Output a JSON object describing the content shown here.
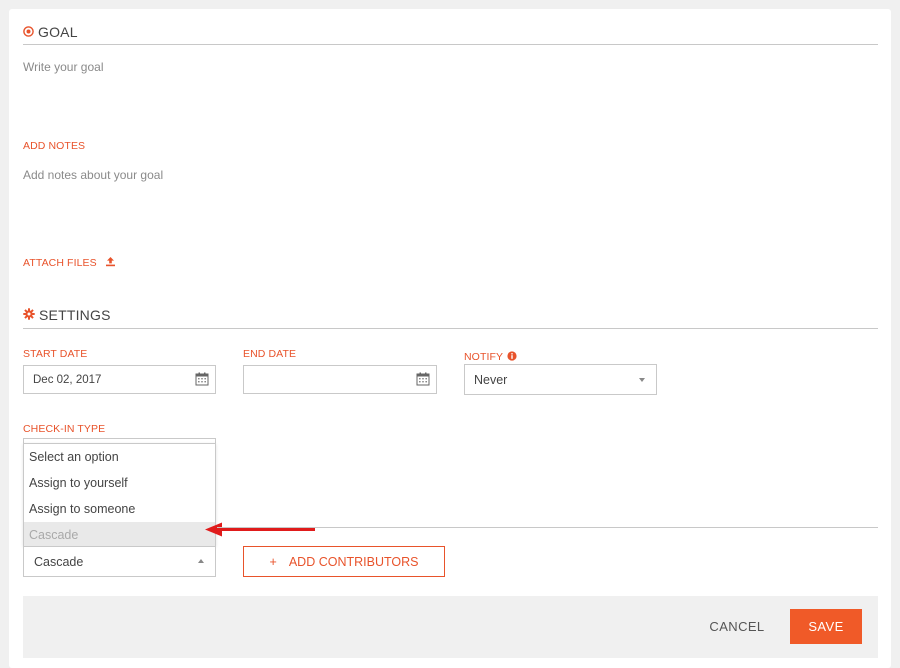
{
  "goal": {
    "title": "GOAL",
    "write_placeholder": "Write your goal",
    "add_notes_label": "ADD NOTES",
    "notes_placeholder": "Add notes about your goal",
    "attach_files_label": "ATTACH FILES"
  },
  "settings": {
    "title": "SETTINGS",
    "start_date": {
      "label": "START DATE",
      "value": "Dec 02, 2017"
    },
    "end_date": {
      "label": "END DATE",
      "value": ""
    },
    "notify": {
      "label": "NOTIFY",
      "value": "Never"
    },
    "check_in_type": {
      "label": "CHECK-IN TYPE",
      "options": [
        "Select an option",
        "Assign to yourself",
        "Assign to someone",
        "Cascade"
      ],
      "selected": "Cascade"
    },
    "add_contributors_label": "ADD CONTRIBUTORS",
    "add_plus": "+"
  },
  "footer": {
    "cancel_label": "CANCEL",
    "save_label": "SAVE"
  },
  "colors": {
    "accent": "#e8532b",
    "save_bg": "#f05a28",
    "arrow": "#e01b1b"
  },
  "icons": {
    "goal": "target-icon",
    "settings": "gear-icon",
    "upload": "upload-icon",
    "calendar": "calendar-icon",
    "info": "info-icon"
  }
}
